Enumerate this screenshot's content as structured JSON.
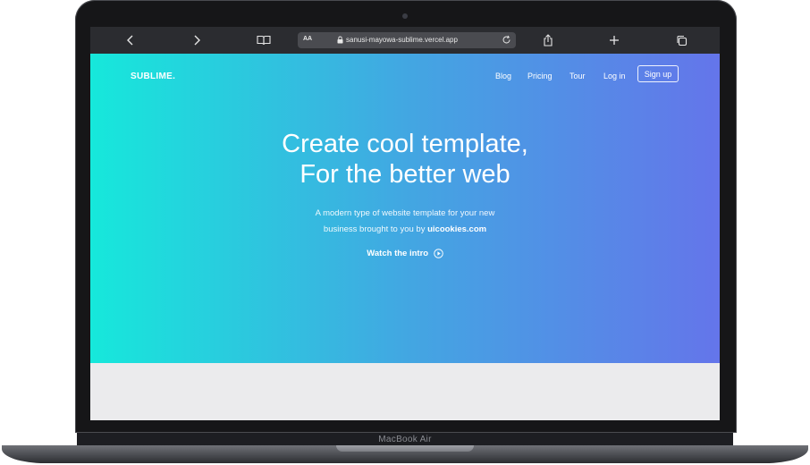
{
  "browser": {
    "address_aa": "AA",
    "url": "sanusi-mayowa-sublime.vercel.app"
  },
  "site": {
    "logo": "SUBLIME.",
    "nav": [
      "Blog",
      "Pricing",
      "Tour",
      "Log in"
    ],
    "signup": "Sign up",
    "headline_line1": "Create cool template,",
    "headline_line2": "For the better web",
    "sub_line1": "A modern type of website template for your new",
    "sub_line2_prefix": "business brought to you by",
    "sub_line2_link": "uicookies.com",
    "watch": "Watch the intro"
  },
  "device": {
    "label": "MacBook Air"
  },
  "colors": {
    "gradient_start": "#16e8db",
    "gradient_end": "#6475ea",
    "toolbar": "#2b2c30"
  },
  "icons": {
    "back": "chevron-left-icon",
    "forward": "chevron-right-icon",
    "bookmarks": "book-icon",
    "lock": "lock-icon",
    "reload": "reload-icon",
    "share": "share-icon",
    "new_tab": "plus-icon",
    "tabs": "tabs-icon",
    "play": "play-circle-icon"
  }
}
